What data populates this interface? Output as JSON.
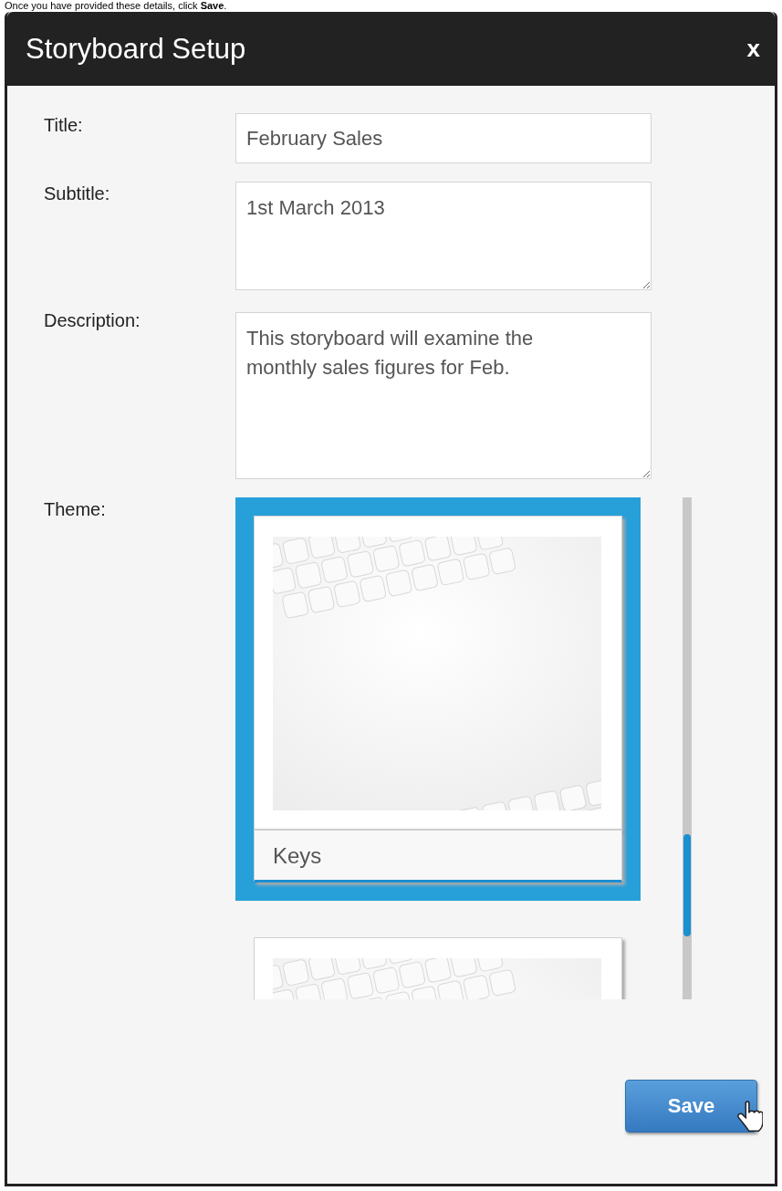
{
  "instruction": "Once you have provided these details, click **Save**.",
  "dialog": {
    "title": "Storyboard Setup",
    "close": "x",
    "fields": [
      {
        "label": "Title:",
        "kind": "input",
        "value": "February Sales"
      },
      {
        "label": "Subtitle:",
        "kind": "textarea",
        "value": "1st March 2013"
      },
      {
        "label": "Description:",
        "kind": "textarea_tall",
        "value": "This storyboard will examine the monthly sales figures for Feb."
      }
    ],
    "theme": {
      "label": "Theme:",
      "items": [
        {
          "name": "Keys",
          "selected": true
        },
        {
          "selected": false
        }
      ]
    },
    "buttons": [
      {
        "label": "Save"
      }
    ]
  }
}
